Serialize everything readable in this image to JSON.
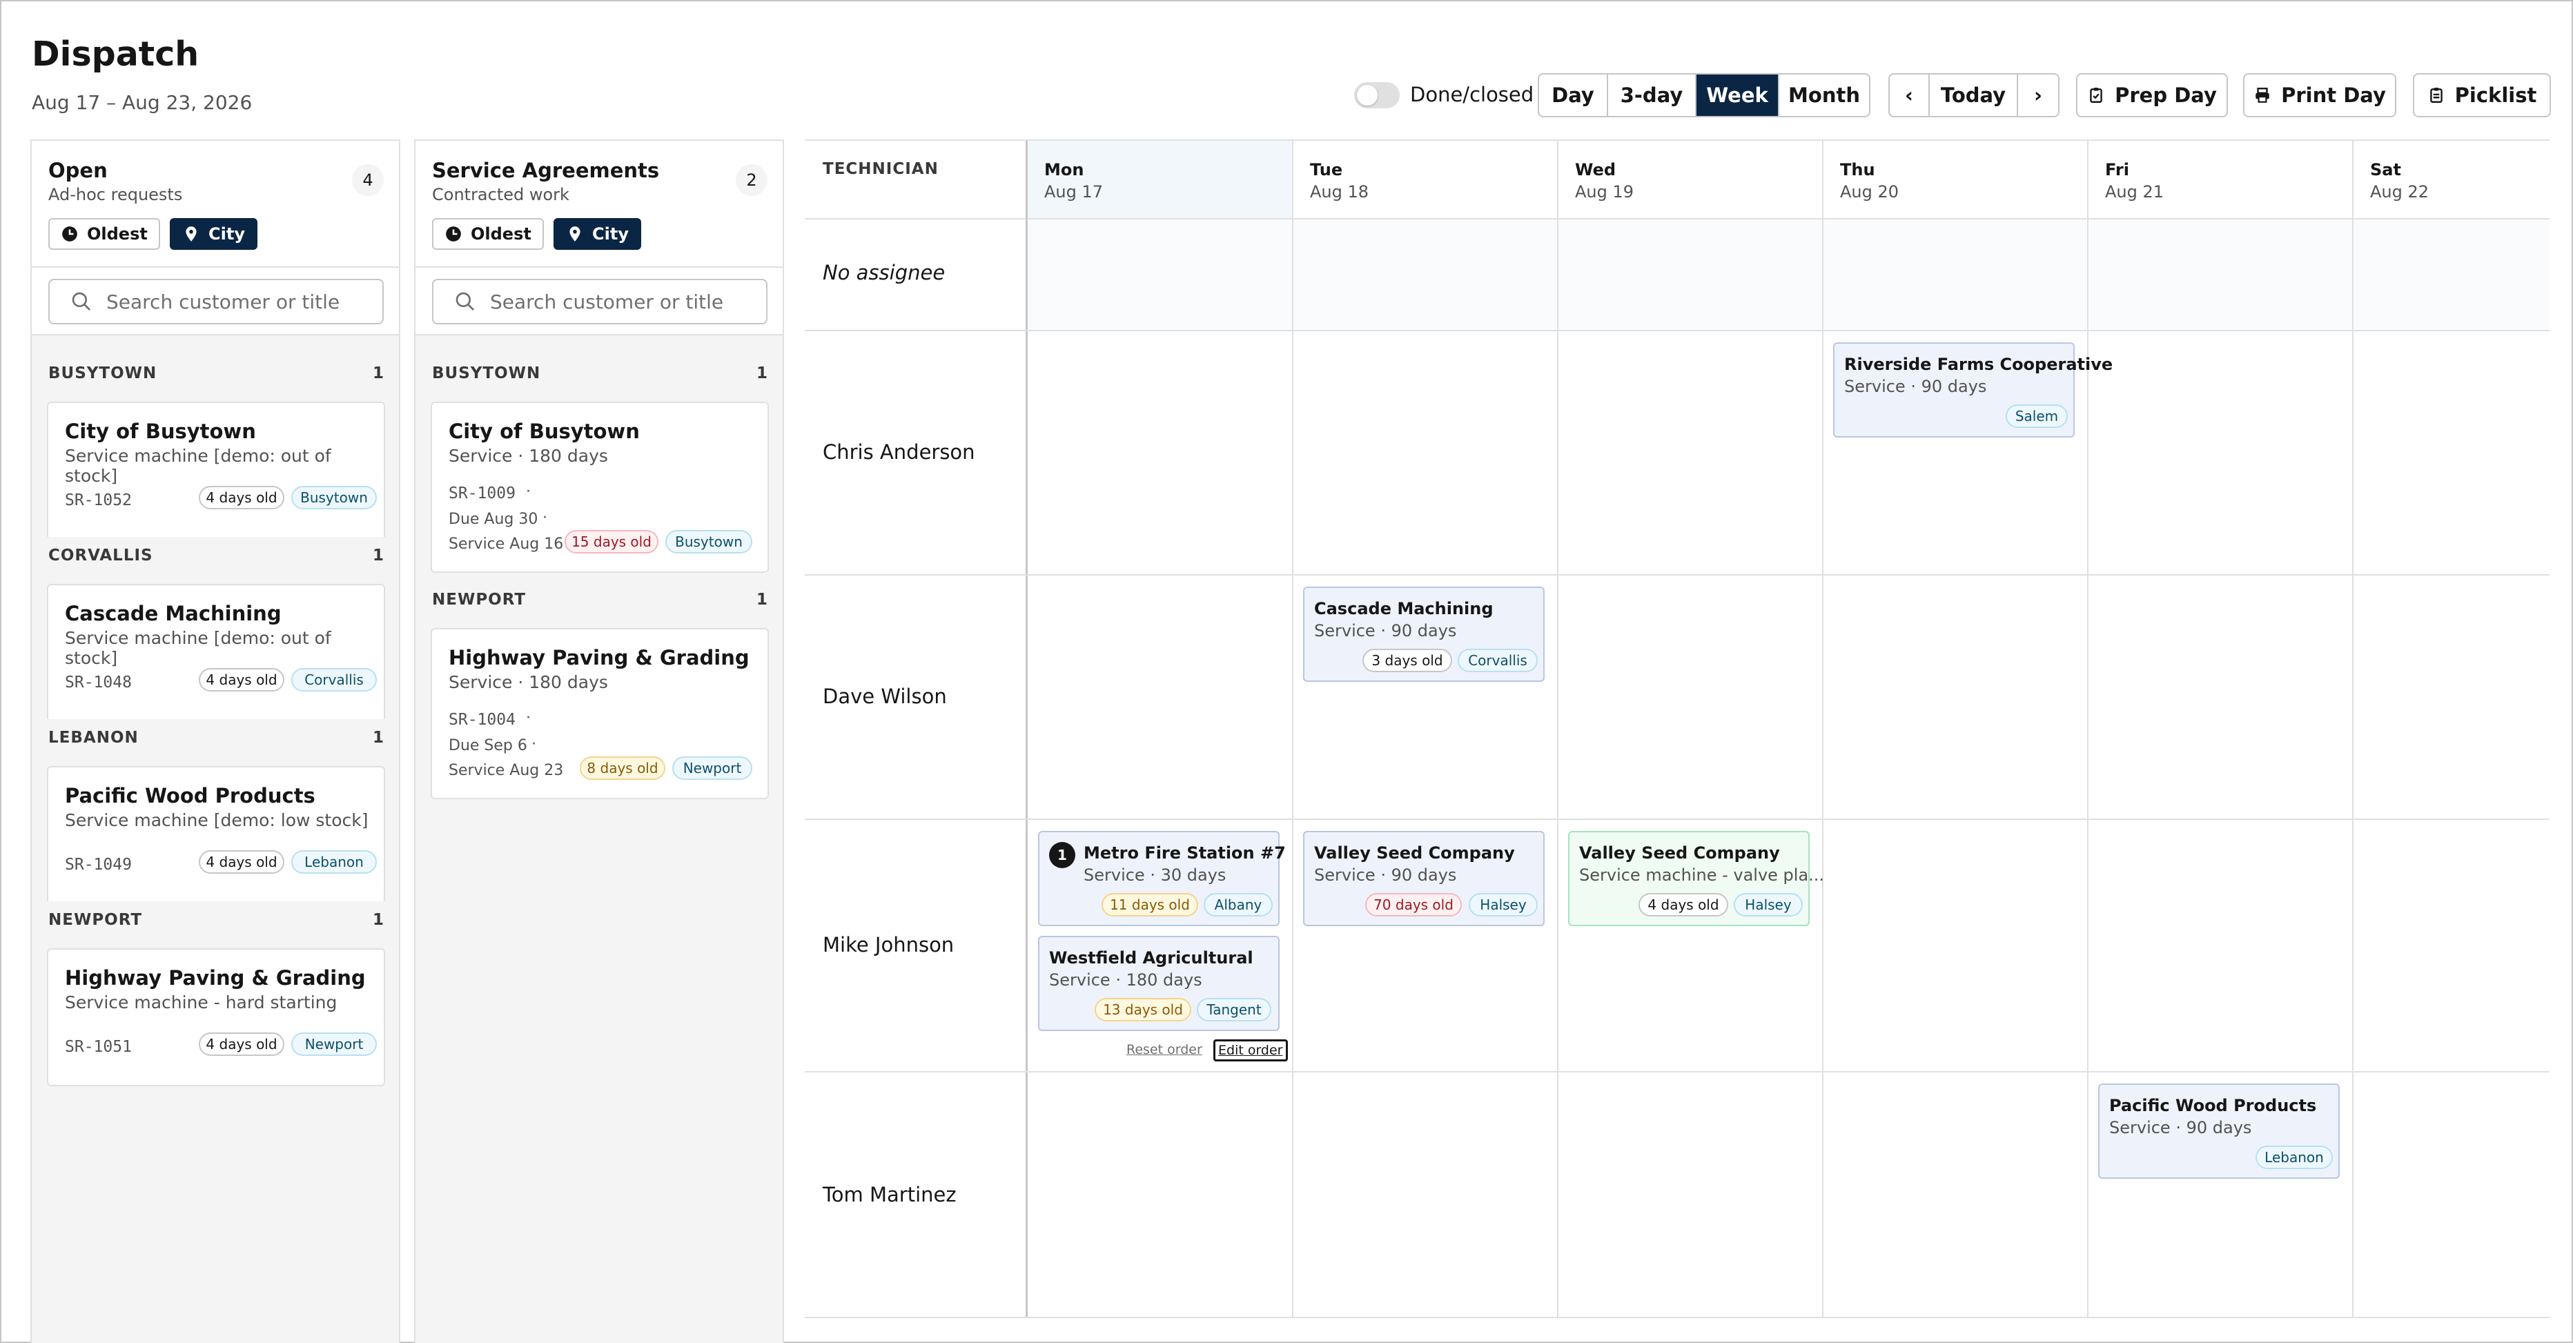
{
  "header": {
    "title": "Dispatch",
    "range": "Aug 17 – Aug 23, 2026"
  },
  "toolbar": {
    "done_closed_label": "Done/closed",
    "views": [
      "Day",
      "3-day",
      "Week",
      "Month"
    ],
    "active_view": "Week",
    "prev": "‹",
    "today": "Today",
    "next": "›",
    "prep_day": "Prep Day",
    "print_day": "Print Day",
    "picklist": "Picklist"
  },
  "open_panel": {
    "title": "Open",
    "subtitle": "Ad-hoc requests",
    "count": "4",
    "sort_oldest": "Oldest",
    "sort_city": "City",
    "search_placeholder": "Search customer or title",
    "groups": [
      {
        "name": "BUSYTOWN",
        "count": "1",
        "card": {
          "title": "City of Busytown",
          "sub": "Service machine [demo: out of stock]",
          "id": "SR-1052",
          "age": "4 days old",
          "city": "Busytown"
        }
      },
      {
        "name": "CORVALLIS",
        "count": "1",
        "card": {
          "title": "Cascade Machining",
          "sub": "Service machine [demo: out of stock]",
          "id": "SR-1048",
          "age": "4 days old",
          "city": "Corvallis"
        }
      },
      {
        "name": "LEBANON",
        "count": "1",
        "card": {
          "title": "Pacific Wood Products",
          "sub": "Service machine [demo: low stock]",
          "id": "SR-1049",
          "age": "4 days old",
          "city": "Lebanon"
        }
      },
      {
        "name": "NEWPORT",
        "count": "1",
        "card": {
          "title": "Highway Paving & Grading",
          "sub": "Service machine - hard starting",
          "id": "SR-1051",
          "age": "4 days old",
          "city": "Newport"
        }
      }
    ]
  },
  "agreements_panel": {
    "title": "Service Agreements",
    "subtitle": "Contracted work",
    "count": "2",
    "sort_oldest": "Oldest",
    "sort_city": "City",
    "search_placeholder": "Search customer or title",
    "groups": [
      {
        "name": "BUSYTOWN",
        "count": "1",
        "card": {
          "title": "City of Busytown",
          "sub": "Service · 180 days",
          "id": "SR-1009",
          "due": "Due Aug 30",
          "service": "Service Aug 16",
          "age": "15 days old",
          "city": "Busytown"
        }
      },
      {
        "name": "NEWPORT",
        "count": "1",
        "card": {
          "title": "Highway Paving & Grading",
          "sub": "Service · 180 days",
          "id": "SR-1004",
          "due": "Due Sep 6",
          "service": "Service Aug 23",
          "age": "8 days old",
          "city": "Newport"
        }
      }
    ],
    "dot": "·"
  },
  "calendar": {
    "technician_header": "TECHNICIAN",
    "days": [
      {
        "name": "Mon",
        "date": "Aug 17"
      },
      {
        "name": "Tue",
        "date": "Aug 18"
      },
      {
        "name": "Wed",
        "date": "Aug 19"
      },
      {
        "name": "Thu",
        "date": "Aug 20"
      },
      {
        "name": "Fri",
        "date": "Aug 21"
      },
      {
        "name": "Sat",
        "date": "Aug 22"
      }
    ],
    "rows": [
      {
        "tech": "No assignee"
      },
      {
        "tech": "Chris Anderson"
      },
      {
        "tech": "Dave Wilson"
      },
      {
        "tech": "Mike Johnson"
      },
      {
        "tech": "Tom Martinez"
      }
    ],
    "jobs": {
      "riverside": {
        "title": "Riverside Farms Cooperative",
        "sub": "Service · 90 days",
        "city": "Salem"
      },
      "cascade": {
        "title": "Cascade Machining",
        "sub": "Service · 90 days",
        "age": "3 days old",
        "city": "Corvallis"
      },
      "metro": {
        "order": "1",
        "title": "Metro Fire Station #7",
        "sub": "Service · 30 days",
        "age": "11 days old",
        "city": "Albany"
      },
      "westfield": {
        "title": "Westfield Agricultural",
        "sub": "Service · 180 days",
        "age": "13 days old",
        "city": "Tangent"
      },
      "valley_tue": {
        "title": "Valley Seed Company",
        "sub": "Service · 90 days",
        "age": "70 days old",
        "city": "Halsey"
      },
      "valley_wed": {
        "title": "Valley Seed Company",
        "sub": "Service machine - valve pla...",
        "age": "4 days old",
        "city": "Halsey"
      },
      "pacific": {
        "title": "Pacific Wood Products",
        "sub": "Service · 90 days",
        "city": "Lebanon"
      }
    },
    "reset_order": "Reset order",
    "edit_order": "Edit order"
  },
  "colors": {
    "accent": "#0b2545",
    "job_bg": "#eef2fb",
    "job_green_bg": "#effbf3",
    "danger": "#a2191f",
    "warning": "#8a5a00"
  }
}
